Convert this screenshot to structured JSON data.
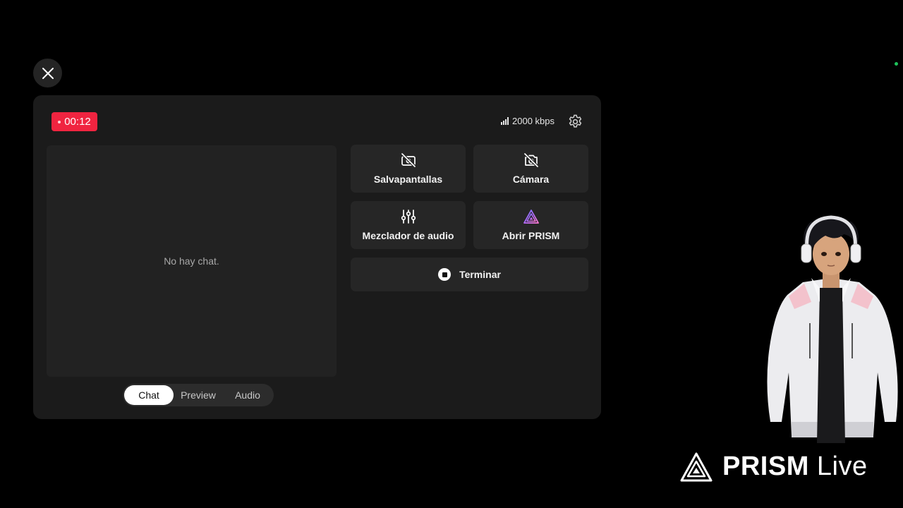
{
  "timer": "00:12",
  "bitrate": "2000 kbps",
  "chat": {
    "empty_message": "No hay chat."
  },
  "tabs": [
    {
      "label": "Chat",
      "active": true
    },
    {
      "label": "Preview",
      "active": false
    },
    {
      "label": "Audio",
      "active": false
    }
  ],
  "actions": {
    "screensaver": "Salvapantallas",
    "camera": "Cámara",
    "audio_mixer": "Mezclador de audio",
    "open_prism": "Abrir PRISM",
    "end": "Terminar"
  },
  "watermark": {
    "brand": "PRISM",
    "suffix": "Live"
  },
  "colors": {
    "rec": "#f02440",
    "panel": "#1b1b1b",
    "tile": "#262626",
    "status_dot": "#1ec25a"
  },
  "icons": {
    "close": "close-icon",
    "signal": "signal-icon",
    "settings": "gear-icon",
    "screensaver": "screensaver-off-icon",
    "camera": "camera-off-icon",
    "mixer": "sliders-icon",
    "prism": "prism-logo-icon",
    "end": "stop-icon"
  }
}
